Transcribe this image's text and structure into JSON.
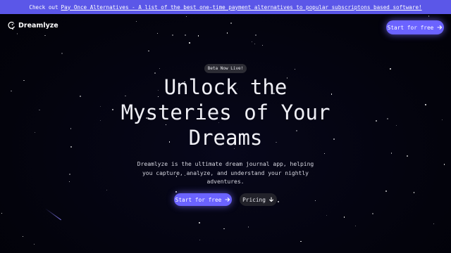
{
  "banner": {
    "prefix": "Check out",
    "link_text": "Pay Once Alternatives - A list of the best one-time payment alternatives to popular subscriptons based software!",
    "bg_color": "#5b57e8"
  },
  "header": {
    "logo_text": "Dreamlyze",
    "logo_icon": "moon-icon",
    "cta_label": "Start for free",
    "cta_icon": "arrow-right-icon"
  },
  "hero": {
    "badge": "Beta Now Live!",
    "headline_lines": [
      "Unlock the",
      "Mysteries of Your",
      "Dreams"
    ],
    "subtitle_lines": [
      "Dreamlyze is the ultimate dream journal app, helping",
      "you capture, analyze, and understand your nightly",
      "adventures."
    ],
    "primary_cta": "Start for free",
    "primary_cta_icon": "arrow-right-icon",
    "secondary_cta": "Pricing",
    "secondary_cta_icon": "arrow-down-icon"
  },
  "colors": {
    "accent": "#6b63ff",
    "background": "#040410",
    "secondary_button": "#22222a"
  }
}
